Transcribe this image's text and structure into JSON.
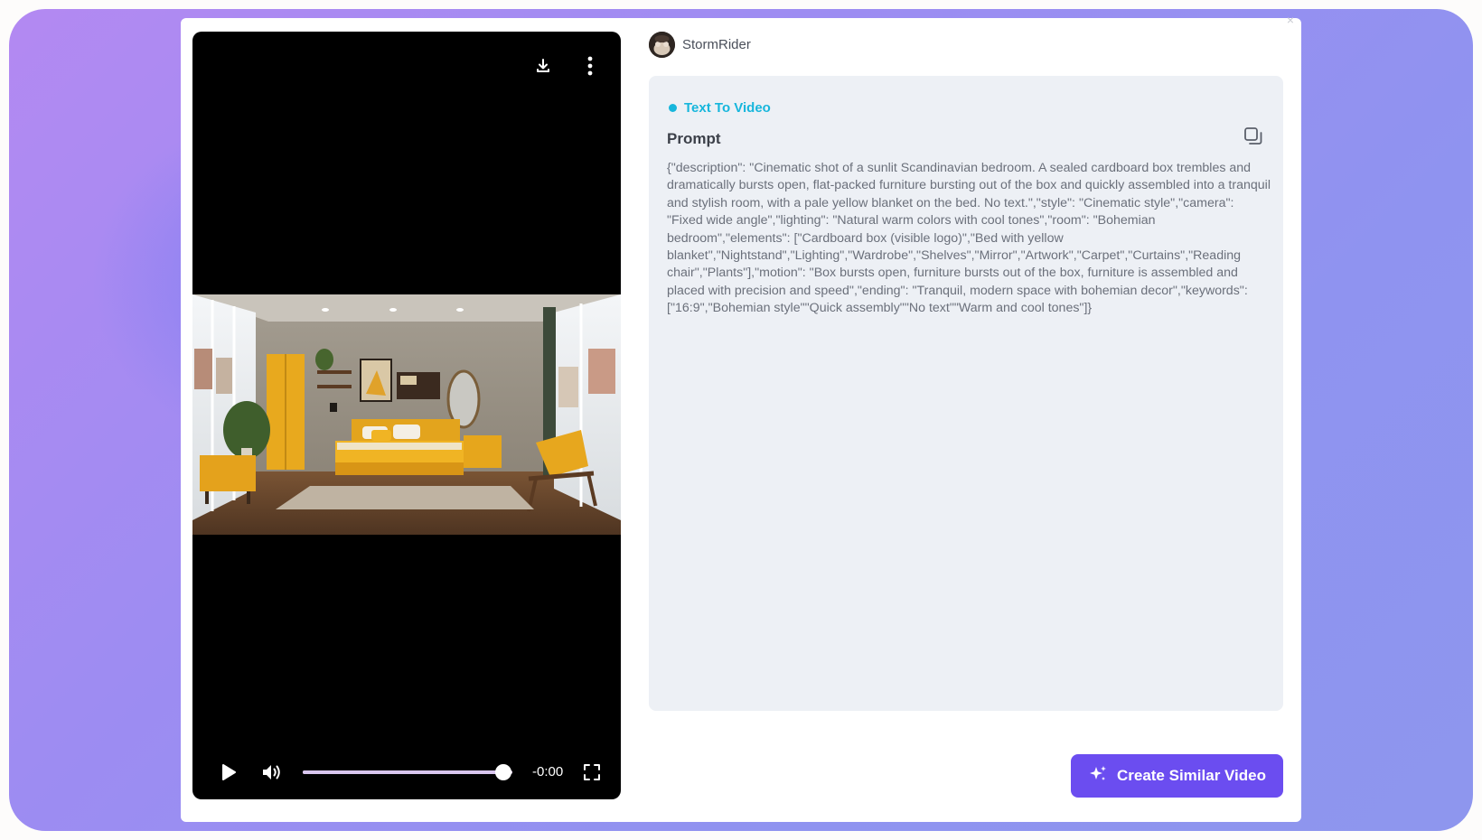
{
  "header": {
    "username": "StormRider"
  },
  "player": {
    "time": "-0:00",
    "progress_fraction": 0.955
  },
  "info": {
    "tag": "Text To Video",
    "prompt_title": "Prompt",
    "prompt_text": "{\"description\": \"Cinematic shot of a sunlit Scandinavian bedroom. A sealed cardboard box trembles and dramatically bursts open, flat-packed furniture bursting out of the box and quickly assembled into a tranquil and stylish room, with a pale yellow blanket on the bed. No text.\",\"style\": \"Cinematic style\",\"camera\": \"Fixed wide angle\",\"lighting\": \"Natural warm colors with cool tones\",\"room\": \"Bohemian bedroom\",\"elements\": [\"Cardboard box (visible logo)\",\"Bed with yellow blanket\",\"Nightstand\",\"Lighting\",\"Wardrobe\",\"Shelves\",\"Mirror\",\"Artwork\",\"Carpet\",\"Curtains\",\"Reading chair\",\"Plants\"],\"motion\": \"Box bursts open, furniture bursts out of the box, furniture is assembled and placed with precision and speed\",\"ending\": \"Tranquil, modern space with bohemian decor\",\"keywords\": [\"16:9\",\"Bohemian style\"\"Quick assembly\"\"No text\"\"Warm and cool tones\"]}"
  },
  "actions": {
    "create_similar": "Create Similar Video"
  },
  "colors": {
    "accent": "#6b4df0",
    "tag": "#17b6dc",
    "panel": "#edf0f5"
  },
  "icons": {
    "download": "download-icon",
    "more": "more-vertical-icon",
    "play": "play-icon",
    "volume": "volume-icon",
    "fullscreen": "fullscreen-icon",
    "copy": "copy-icon",
    "sparkle": "sparkle-icon",
    "close": "close-icon"
  }
}
